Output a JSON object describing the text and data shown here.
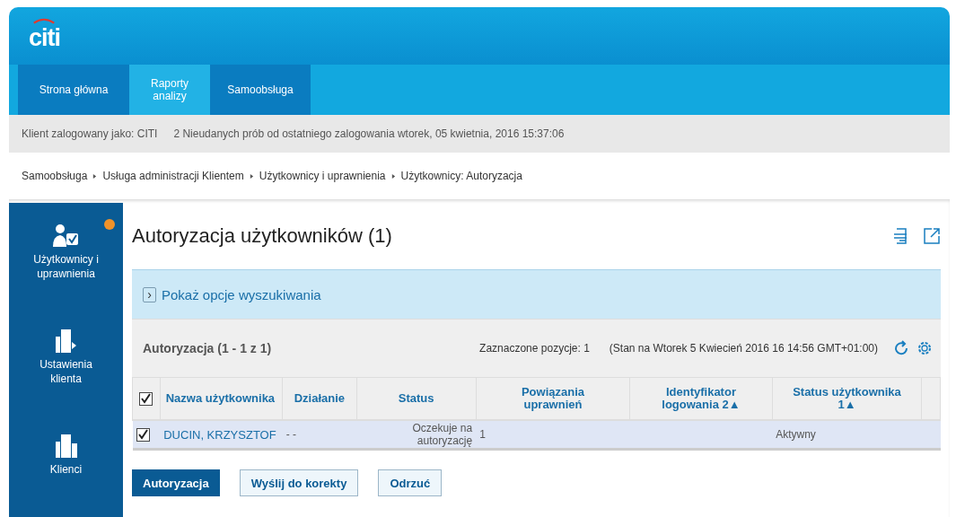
{
  "logo": "citi",
  "nav": [
    {
      "label": "Strona główna",
      "selected": false
    },
    {
      "label": "Raporty analizy",
      "selected": true
    },
    {
      "label": "Samoobsługa",
      "selected": false
    }
  ],
  "info_bar": {
    "user": "Klient zalogowany jako: CITI",
    "failed_logins": "2 Nieudanych prób od ostatniego zalogowania wtorek, 05 kwietnia, 2016 15:37:06"
  },
  "breadcrumb": [
    "Samoobsługa",
    "Usługa administracji Klientem",
    "Użytkownicy i uprawnienia",
    "Użytkownicy: Autoryzacja"
  ],
  "sidebar": {
    "items": [
      {
        "label": "Użytkownicy i uprawnienia",
        "kind": "users",
        "notification": true
      },
      {
        "label": "Ustawienia klienta",
        "kind": "settings",
        "notification": false
      },
      {
        "label": "Klienci",
        "kind": "clients",
        "notification": false
      }
    ]
  },
  "page_title": "Autoryzacja użytkowników (1)",
  "search_toggle": {
    "icon": "›",
    "label": "Pokaż opcje wyszukiwania"
  },
  "table": {
    "caption": "Autoryzacja (1 - 1 z 1)",
    "selected_count": "Zaznaczone pozycje: 1",
    "as_of": "(Stan na Wtorek 5 Kwiecień 2016 16 14:56 GMT+01:00)",
    "all_checked": true,
    "columns": [
      {
        "label": "Nazwa użytkownika"
      },
      {
        "label": "Działanie"
      },
      {
        "label": "Status"
      },
      {
        "label": "Powiązania uprawnień"
      },
      {
        "label": "Identyfikator logowania",
        "sort": "2",
        "sort_mark": "▲"
      },
      {
        "label": "Status użytkownika",
        "sort": "1",
        "sort_mark": "▲"
      }
    ],
    "rows": [
      {
        "checked": true,
        "cells": [
          "DUCIN, KRZYSZTOF",
          "- -",
          "Oczekuje na autoryzację",
          "1",
          "",
          "Aktywny"
        ]
      }
    ]
  },
  "buttons": [
    {
      "label": "Autoryzacja",
      "kind": "primary"
    },
    {
      "label": "Wyślij do korekty",
      "kind": "secondary"
    },
    {
      "label": "Odrzuć",
      "kind": "secondary"
    }
  ]
}
